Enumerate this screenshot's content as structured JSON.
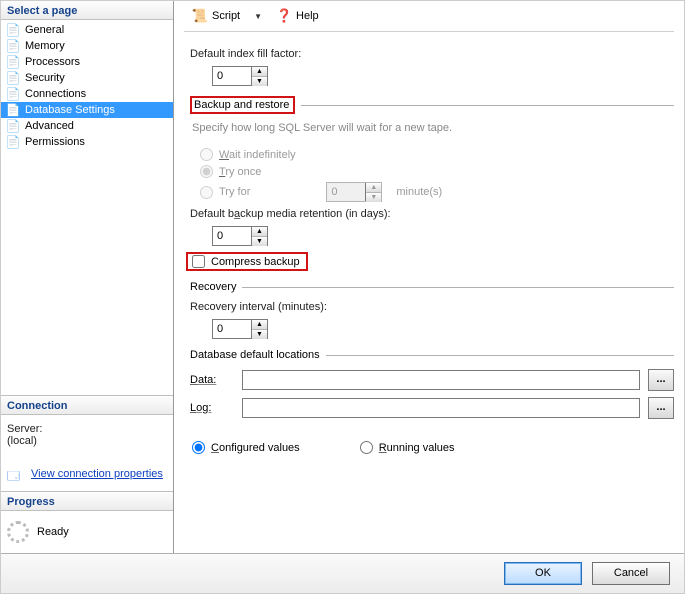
{
  "left": {
    "select_a_page": "Select a page",
    "items": [
      {
        "label": "General"
      },
      {
        "label": "Memory"
      },
      {
        "label": "Processors"
      },
      {
        "label": "Security"
      },
      {
        "label": "Connections"
      },
      {
        "label": "Database Settings",
        "selected": true
      },
      {
        "label": "Advanced"
      },
      {
        "label": "Permissions"
      }
    ],
    "connection": {
      "heading": "Connection",
      "server_label": "Server:",
      "server_value": "(local)",
      "view_props": "View connection properties"
    },
    "progress": {
      "heading": "Progress",
      "status": "Ready"
    }
  },
  "toolbar": {
    "script": "Script",
    "help": "Help"
  },
  "form": {
    "fill_factor_label": "Default index fill factor:",
    "fill_factor_value": "0",
    "backup_heading": "Backup and restore",
    "backup_hint": "Specify how long SQL Server will wait for a new tape.",
    "wait_indef": "Wait indefinitely",
    "try_once": "Try once",
    "try_for": "Try for",
    "try_for_value": "0",
    "try_for_unit": "minute(s)",
    "retention_label": "Default backup media retention (in days):",
    "retention_value": "0",
    "compress_label": "Compress backup",
    "recovery_heading": "Recovery",
    "recovery_interval_label": "Recovery interval (minutes):",
    "recovery_interval_value": "0",
    "locations_heading": "Database default locations",
    "data_label": "Data:",
    "data_value": "",
    "log_label": "Log:",
    "log_value": "",
    "browse": "...",
    "configured": "Configured values",
    "running": "Running values"
  },
  "footer": {
    "ok": "OK",
    "cancel": "Cancel"
  }
}
